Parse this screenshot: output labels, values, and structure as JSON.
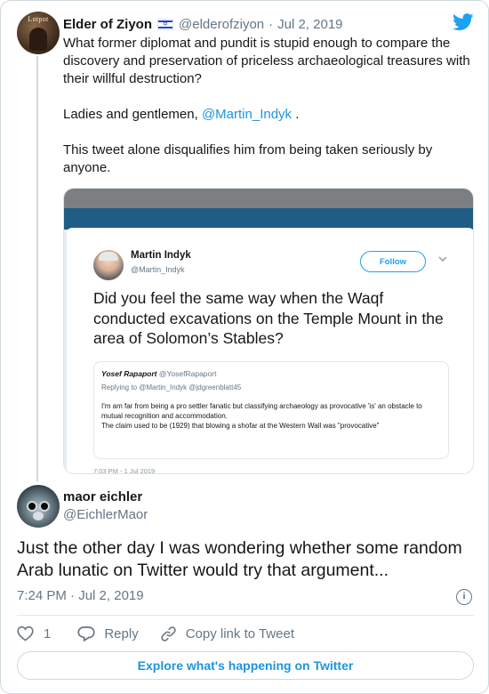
{
  "colors": {
    "link": "#1b95e0",
    "secondary_text": "#657786",
    "primary_text": "#14171a",
    "border": "#cfd9de"
  },
  "parent_tweet": {
    "avatar_text": "Lotpot",
    "name": "Elder of Ziyon",
    "name_emoji": "israel-flag-icon",
    "handle": "@elderofziyon",
    "separator": "·",
    "date": "Jul 2, 2019",
    "text": {
      "p1": "What former diplomat and pundit is stupid enough to compare the discovery and preservation of priceless archaeological treasures with their willful destruction?",
      "p2_before": "Ladies and gentlemen, ",
      "p2_mention": "@Martin_Indyk",
      "p2_after": " .",
      "p3": "This tweet alone disqualifies him from being taken seriously by anyone."
    },
    "media": {
      "name": "Martin Indyk",
      "handle": "@Martin_Indyk",
      "follow_label": "Follow",
      "text": "Did you feel the same way when the Waqf conducted excavations on the Temple Mount in the area of Solomon’s Stables?",
      "quote": {
        "name": "Yosef Rapaport",
        "handle": "@YosefRapaport",
        "replying": "Replying to @Martin_Indyk @jdgreenblatt45",
        "body_1": "I'm am far from being a pro settler fanatic but classifying archaeology as provocative 'is' an obstacle to mutual recognition and accommodation.",
        "body_2": "The claim used to be (1929) that blowing a shofar at the Western Wall was \"provocative\""
      },
      "time": "7:03 PM - 1 Jul 2019"
    }
  },
  "main_tweet": {
    "name": "maor eichler",
    "handle": "@EichlerMaor",
    "text": "Just the other day I was wondering whether some random Arab lunatic on Twitter would try that argument...",
    "time": "7:24 PM",
    "separator": "·",
    "date": "Jul 2, 2019",
    "actions": {
      "like_count": "1",
      "reply_label": "Reply",
      "copy_label": "Copy link to Tweet"
    }
  },
  "explore_label": "Explore what's happening on Twitter"
}
